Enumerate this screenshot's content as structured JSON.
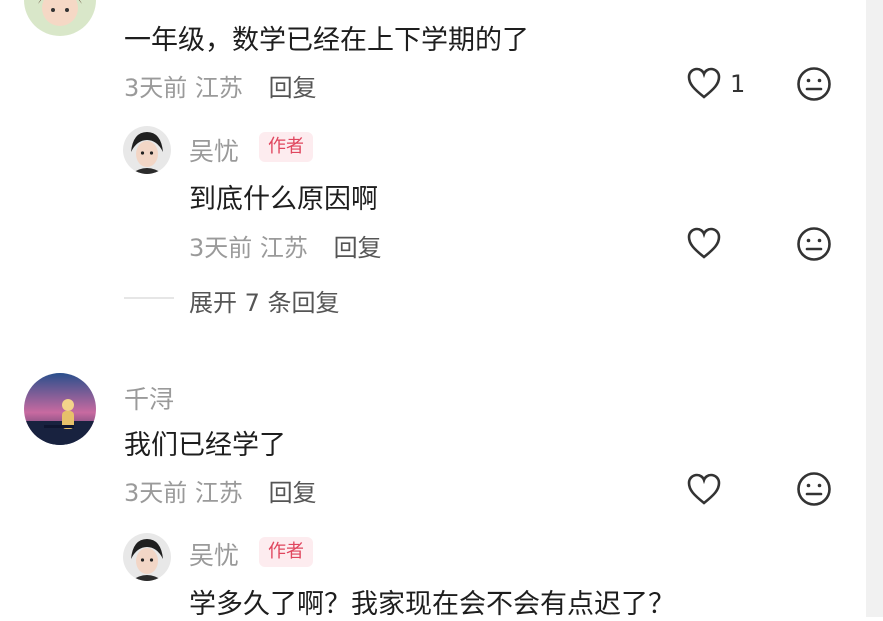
{
  "comments": [
    {
      "text": "一年级，数学已经在上下学期的了",
      "time": "3天前",
      "location": "江苏",
      "reply_label": "回复",
      "likes": "1",
      "reply": {
        "author": "吴忧",
        "tag": "作者",
        "text": "到底什么原因啊",
        "time": "3天前",
        "location": "江苏",
        "reply_label": "回复"
      },
      "expand_label": "展开 7 条回复"
    },
    {
      "author": "千浔",
      "text": "我们已经学了",
      "time": "3天前",
      "location": "江苏",
      "reply_label": "回复",
      "reply": {
        "author": "吴忧",
        "tag": "作者",
        "text": "学多久了啊？我家现在会不会有点迟了？"
      }
    }
  ],
  "icons": {
    "like": "heart-outline-icon",
    "dislike": "neutral-face-icon"
  }
}
